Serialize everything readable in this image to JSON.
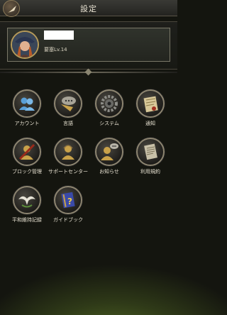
{
  "header": {
    "title": "設定",
    "back_icon": "feather-scroll-icon"
  },
  "profile": {
    "name": "",
    "level_text": "要塞Lv.14"
  },
  "menu": [
    {
      "label": "アカウント",
      "icon": "account-people-icon"
    },
    {
      "label": "言語",
      "icon": "language-speech-icon"
    },
    {
      "label": "システム",
      "icon": "gear-icon"
    },
    {
      "label": "通知",
      "icon": "notification-letter-icon"
    },
    {
      "label": "ブロック管理",
      "icon": "block-icon"
    },
    {
      "label": "サポートセンター",
      "icon": "support-icon"
    },
    {
      "label": "お知らせ",
      "icon": "announcement-icon"
    },
    {
      "label": "利用規約",
      "icon": "terms-scroll-icon"
    },
    {
      "label": "平和維持記録",
      "icon": "peace-dove-icon"
    },
    {
      "label": "ガイドブック",
      "icon": "guidebook-icon"
    }
  ]
}
